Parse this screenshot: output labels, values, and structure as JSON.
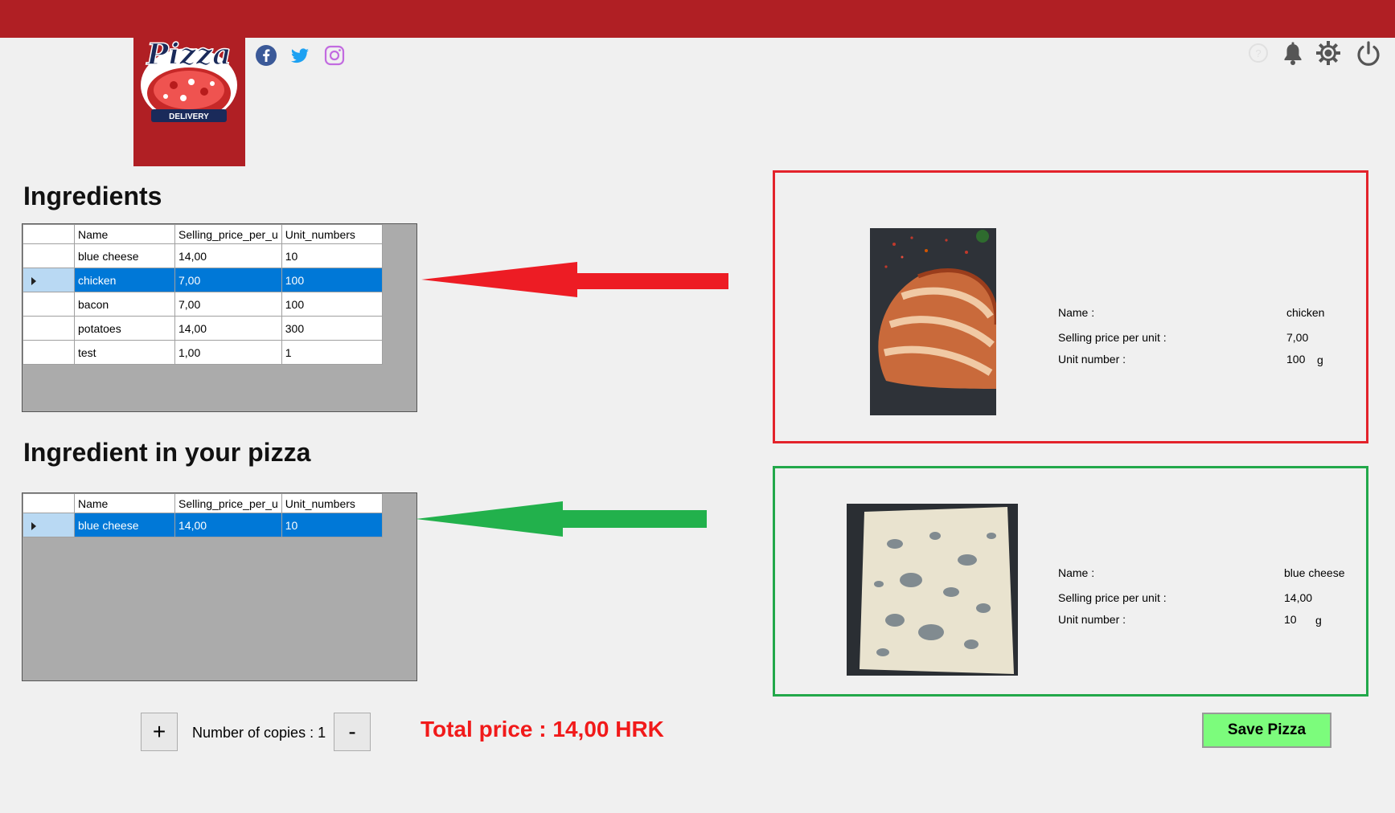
{
  "logo": {
    "text": "Pizza",
    "sub_text": "DELIVERY"
  },
  "social": [
    "facebook-icon",
    "twitter-icon",
    "instagram-icon"
  ],
  "system_icons": [
    "help-icon",
    "bell-icon",
    "gear-icon",
    "power-icon"
  ],
  "ingredients": {
    "title": "Ingredients",
    "columns": [
      "Name",
      "Selling_price_per_u",
      "Unit_numbers"
    ],
    "rows": [
      {
        "name": "blue cheese",
        "price": "14,00",
        "units": "10"
      },
      {
        "name": "chicken",
        "price": "7,00",
        "units": "100"
      },
      {
        "name": "bacon",
        "price": "7,00",
        "units": "100"
      },
      {
        "name": "potatoes",
        "price": "14,00",
        "units": "300"
      },
      {
        "name": "test",
        "price": "1,00",
        "units": "1"
      }
    ],
    "selected_index": 1
  },
  "pizza_ingredients": {
    "title": "Ingredient in your pizza",
    "columns": [
      "Name",
      "Selling_price_per_u",
      "Unit_numbers"
    ],
    "rows": [
      {
        "name": "blue cheese",
        "price": "14,00",
        "units": "10"
      }
    ],
    "selected_index": 0
  },
  "selected_detail": {
    "border_color": "#e3232b",
    "name_label": "Name :",
    "price_label": "Selling price per unit :",
    "unit_label": "Unit number :",
    "name": "chicken",
    "price": "7,00",
    "units": "100",
    "unit_suffix": "g"
  },
  "pizza_detail": {
    "border_color": "#22a84a",
    "name_label": "Name :",
    "price_label": "Selling price per unit :",
    "unit_label": "Unit number :",
    "name": "blue cheese",
    "price": "14,00",
    "units": "10",
    "unit_suffix": "g"
  },
  "footer": {
    "plus_label": "+",
    "minus_label": "-",
    "copies_label": "Number of copies : 1",
    "total_label": "Total price : 14,00 HRK",
    "save_label": "Save Pizza"
  },
  "colors": {
    "topbar": "#b01f24",
    "red_arrow": "#ed1c24",
    "green_arrow": "#22b14c",
    "total": "#f11a1a",
    "save_button": "#7cfc7c",
    "selection": "#0078d7"
  }
}
